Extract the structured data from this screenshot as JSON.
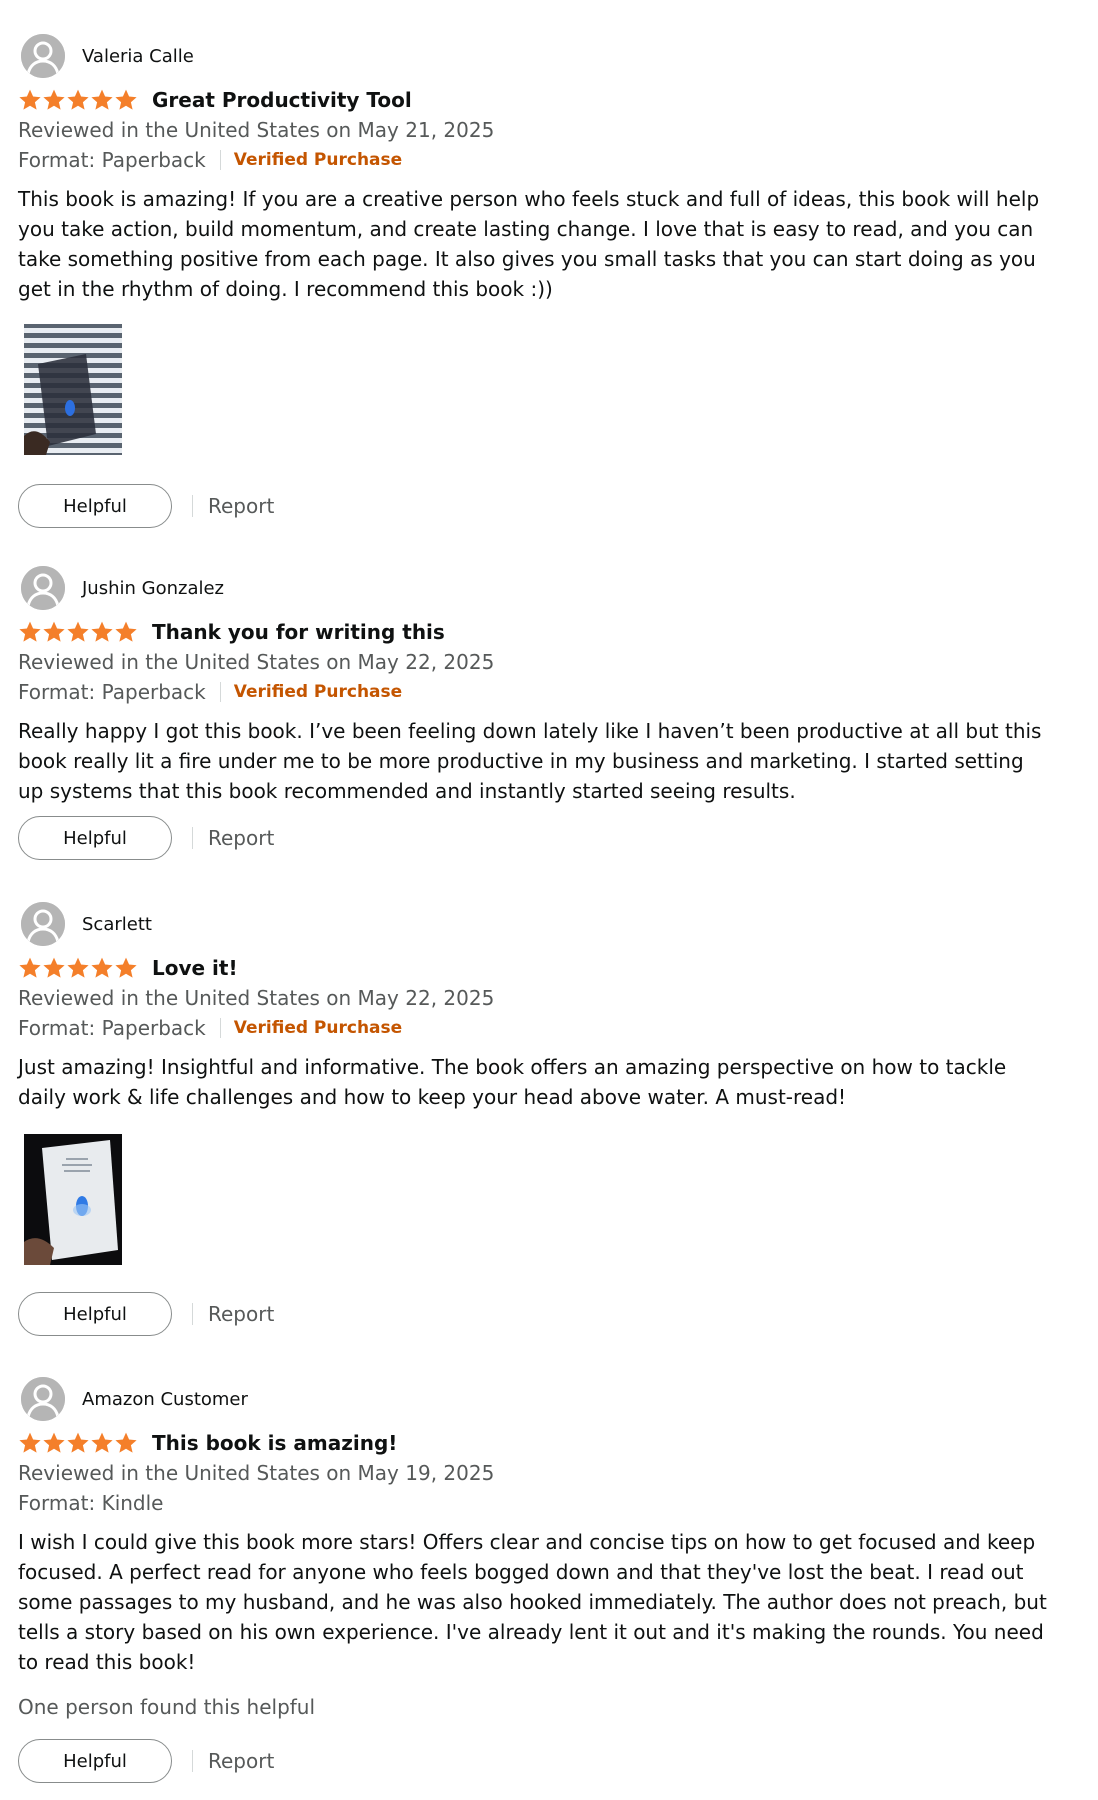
{
  "colors": {
    "star": "#f47f2a",
    "verified": "#c45500",
    "muted_text": "#565959",
    "main_text": "#0f1111",
    "button_border": "#888c8c",
    "avatar_bg": "#b5b5b5"
  },
  "icons": {
    "avatar": "user-silhouette-icon",
    "star": "star-icon"
  },
  "reviews": [
    {
      "reviewer": "Valeria Calle",
      "rating": 5,
      "title": "Great Productivity Tool",
      "date": "Reviewed in the United States on May 21, 2025",
      "format": "Format: Paperback",
      "verified": "Verified Purchase",
      "body": "This book is amazing! If you are a creative person who feels stuck and full of ideas, this book will help you take action, build momentum, and create lasting change. I love that is easy to read, and you can take something positive from each page. It also gives you small tasks that you can start doing as you get in the rhythm of doing. I recommend this book :))",
      "helpful_label": "Helpful",
      "report_label": "Report"
    },
    {
      "reviewer": "Jushin Gonzalez",
      "rating": 5,
      "title": "Thank you for writing this",
      "date": "Reviewed in the United States on May 22, 2025",
      "format": "Format: Paperback",
      "verified": "Verified Purchase",
      "body": "Really happy I got this book. I’ve been feeling down lately like I haven’t been productive at all but this book really lit a fire under me to be more productive in my business and marketing. I started setting up systems that this book recommended and instantly started seeing results.",
      "helpful_label": "Helpful",
      "report_label": "Report"
    },
    {
      "reviewer": "Scarlett",
      "rating": 5,
      "title": "Love it!",
      "date": "Reviewed in the United States on May 22, 2025",
      "format": "Format: Paperback",
      "verified": "Verified Purchase",
      "body": "Just amazing! Insightful and informative. The book offers an amazing perspective on how to tackle daily work & life challenges and how to keep your head above water. A must-read!",
      "helpful_label": "Helpful",
      "report_label": "Report"
    },
    {
      "reviewer": "Amazon Customer",
      "rating": 5,
      "title": "This book is amazing!",
      "date": "Reviewed in the United States on May 19, 2025",
      "format": "Format: Kindle",
      "body": "I wish I could give this book more stars! Offers clear and concise tips on how to get focused and keep focused. A perfect read for anyone who feels bogged down and that they've lost the beat. I read out some passages to my husband, and he was also hooked immediately. The author does not preach, but tells a story based on his own experience. I've already lent it out and it's making the rounds. You need to read this book!",
      "helpful_count": "One person found this helpful",
      "helpful_label": "Helpful",
      "report_label": "Report"
    }
  ]
}
